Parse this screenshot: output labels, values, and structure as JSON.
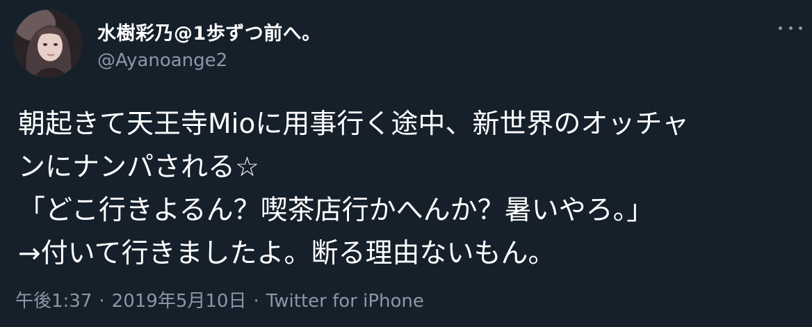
{
  "author": {
    "display_name": "水樹彩乃@1歩ずつ前へ。",
    "handle": "@Ayanoange2",
    "avatar_icon": "profile-photo"
  },
  "menu": {
    "icon": "more-horizontal-icon"
  },
  "tweet": {
    "lines": [
      "朝起きて天王寺Mioに用事行く途中、新世界のオッチャ",
      "ンにナンパされる☆",
      "「どこ行きよるん？喫茶店行かへんか？暑いやろ。」",
      "→付いて行きましたよ。断る理由ないもん。"
    ]
  },
  "meta": {
    "time": "午後1:37",
    "separator": "·",
    "date": "2019年5月10日",
    "source": "Twitter for iPhone"
  },
  "colors": {
    "background": "#15202b",
    "text": "#ffffff",
    "secondary": "#8b98a5"
  }
}
